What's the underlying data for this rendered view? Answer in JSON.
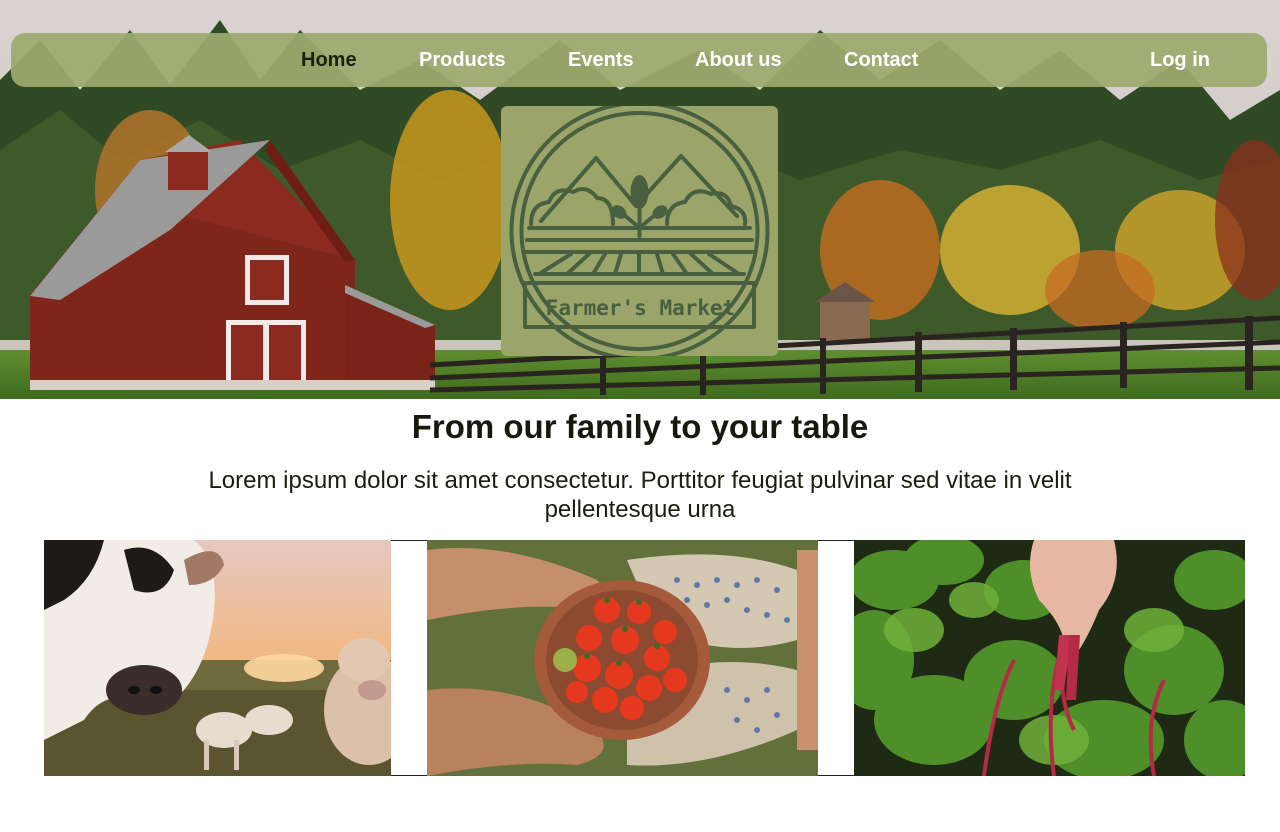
{
  "nav": {
    "items": [
      {
        "label": "Home",
        "active": true
      },
      {
        "label": "Products",
        "active": false
      },
      {
        "label": "Events",
        "active": false
      },
      {
        "label": "About us",
        "active": false
      },
      {
        "label": "Contact",
        "active": false
      }
    ],
    "login_label": "Log in"
  },
  "logo": {
    "text": "Farmer's Market",
    "icon": "farm-field-sprout-emblem"
  },
  "hero": {
    "image": "red-barn-autumn-forest-fence"
  },
  "main": {
    "headline": "From our family to your table",
    "subtext": "Lorem ipsum dolor sit amet consectetur. Porttitor feugiat pulvinar sed vitae in velit pellentesque urna"
  },
  "gallery": [
    {
      "image": "cows-in-pasture-sunset"
    },
    {
      "image": "hands-holding-bowl-of-tomatoes"
    },
    {
      "image": "hands-picking-leafy-greens"
    }
  ],
  "colors": {
    "nav_bg": "#9eaa6e",
    "logo_bg": "#9ba56a",
    "logo_ink": "#48603f",
    "active_nav": "#1c2010",
    "nav_text": "#ffffff",
    "heading": "#161a0e"
  }
}
